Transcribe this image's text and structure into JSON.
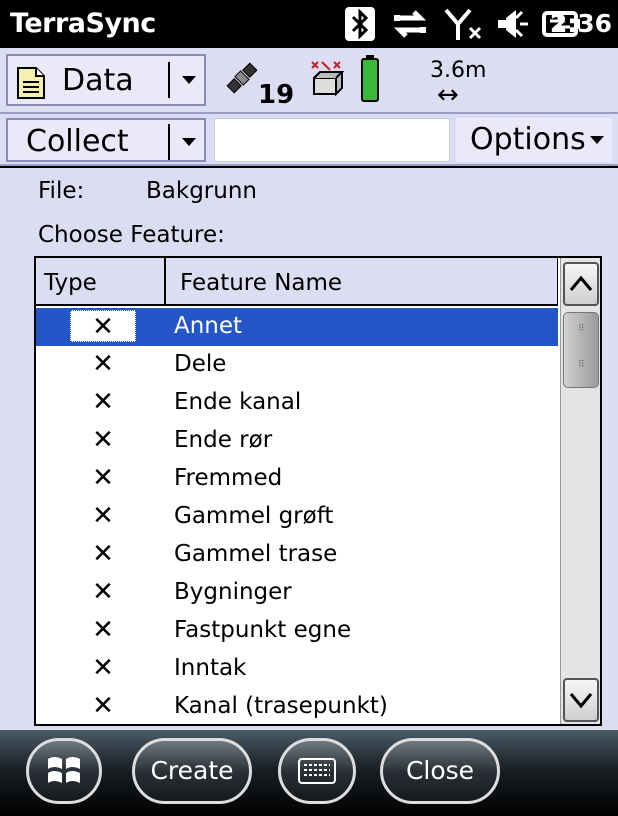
{
  "status_bar": {
    "app_title": "TerraSync",
    "clock": "2:36",
    "icons": [
      "bluetooth-icon",
      "sync-icon",
      "no-signal-icon",
      "volume-icon",
      "battery-charging-icon"
    ]
  },
  "toolbar": {
    "section_label": "Data",
    "satellite_count": "19",
    "precision": "3.6m",
    "precision_arrow": "↔"
  },
  "command_bar": {
    "mode_label": "Collect",
    "options_label": "Options"
  },
  "main": {
    "file_label": "File:",
    "file_value": "Bakgrunn",
    "choose_label": "Choose Feature:",
    "columns": {
      "type": "Type",
      "name": "Feature Name"
    },
    "rows": [
      {
        "type": "✕",
        "name": "Annet",
        "selected": true
      },
      {
        "type": "✕",
        "name": "Dele"
      },
      {
        "type": "✕",
        "name": "Ende kanal"
      },
      {
        "type": "✕",
        "name": "Ende rør"
      },
      {
        "type": "✕",
        "name": "Fremmed"
      },
      {
        "type": "✕",
        "name": "Gammel grøft"
      },
      {
        "type": "✕",
        "name": "Gammel trase"
      },
      {
        "type": "✕",
        "name": "Bygninger"
      },
      {
        "type": "✕",
        "name": "Fastpunkt egne"
      },
      {
        "type": "✕",
        "name": "Inntak"
      },
      {
        "type": "✕",
        "name": "Kanal (trasepunkt)"
      }
    ]
  },
  "taskbar": {
    "create_label": "Create",
    "close_label": "Close"
  },
  "colors": {
    "selection": "#2456c8",
    "panel": "#dcdcf2",
    "statusbar": "#000000"
  }
}
